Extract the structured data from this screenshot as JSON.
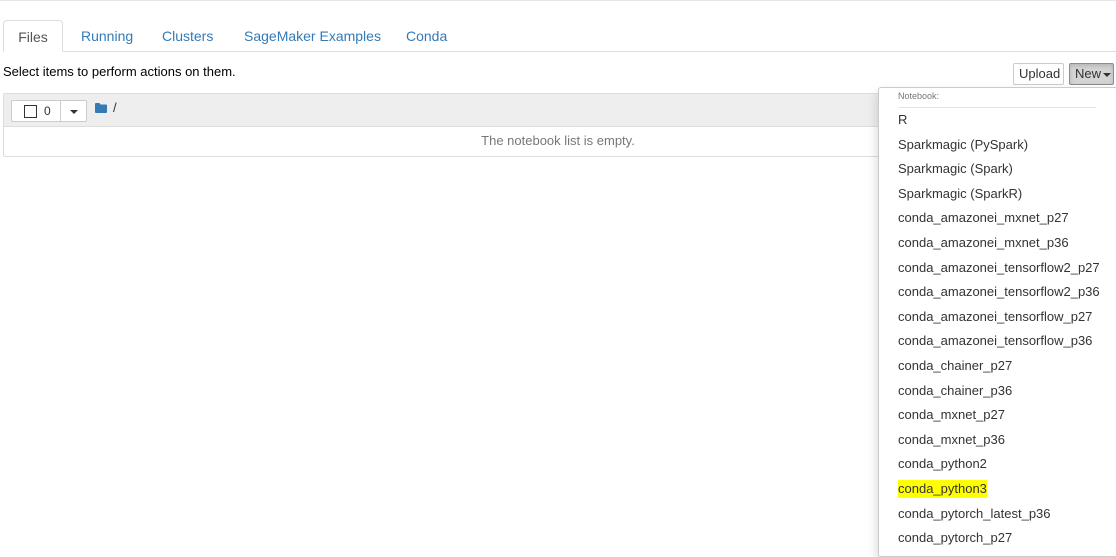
{
  "tabs": [
    {
      "label": "Files",
      "active": true
    },
    {
      "label": "Running"
    },
    {
      "label": "Clusters"
    },
    {
      "label": "SageMaker Examples"
    },
    {
      "label": "Conda"
    }
  ],
  "toolbar": {
    "hint": "Select items to perform actions on them.",
    "upload_label": "Upload",
    "new_label": "New"
  },
  "list": {
    "selected_count": "0",
    "breadcrumb": "/",
    "empty_message": "The notebook list is empty."
  },
  "new_menu": {
    "header": "Notebook:",
    "highlighted_item": "conda_python3",
    "highlight_color": "#ffff00",
    "items": [
      "R",
      "Sparkmagic (PySpark)",
      "Sparkmagic (Spark)",
      "Sparkmagic (SparkR)",
      "conda_amazonei_mxnet_p27",
      "conda_amazonei_mxnet_p36",
      "conda_amazonei_tensorflow2_p27",
      "conda_amazonei_tensorflow2_p36",
      "conda_amazonei_tensorflow_p27",
      "conda_amazonei_tensorflow_p36",
      "conda_chainer_p27",
      "conda_chainer_p36",
      "conda_mxnet_p27",
      "conda_mxnet_p36",
      "conda_python2",
      "conda_python3",
      "conda_pytorch_latest_p36",
      "conda_pytorch_p27"
    ]
  },
  "colors": {
    "link": "#337ab7",
    "folder_icon": "#337ab7"
  },
  "icons": {
    "folder": "folder-icon",
    "caret": "caret-down-icon"
  }
}
